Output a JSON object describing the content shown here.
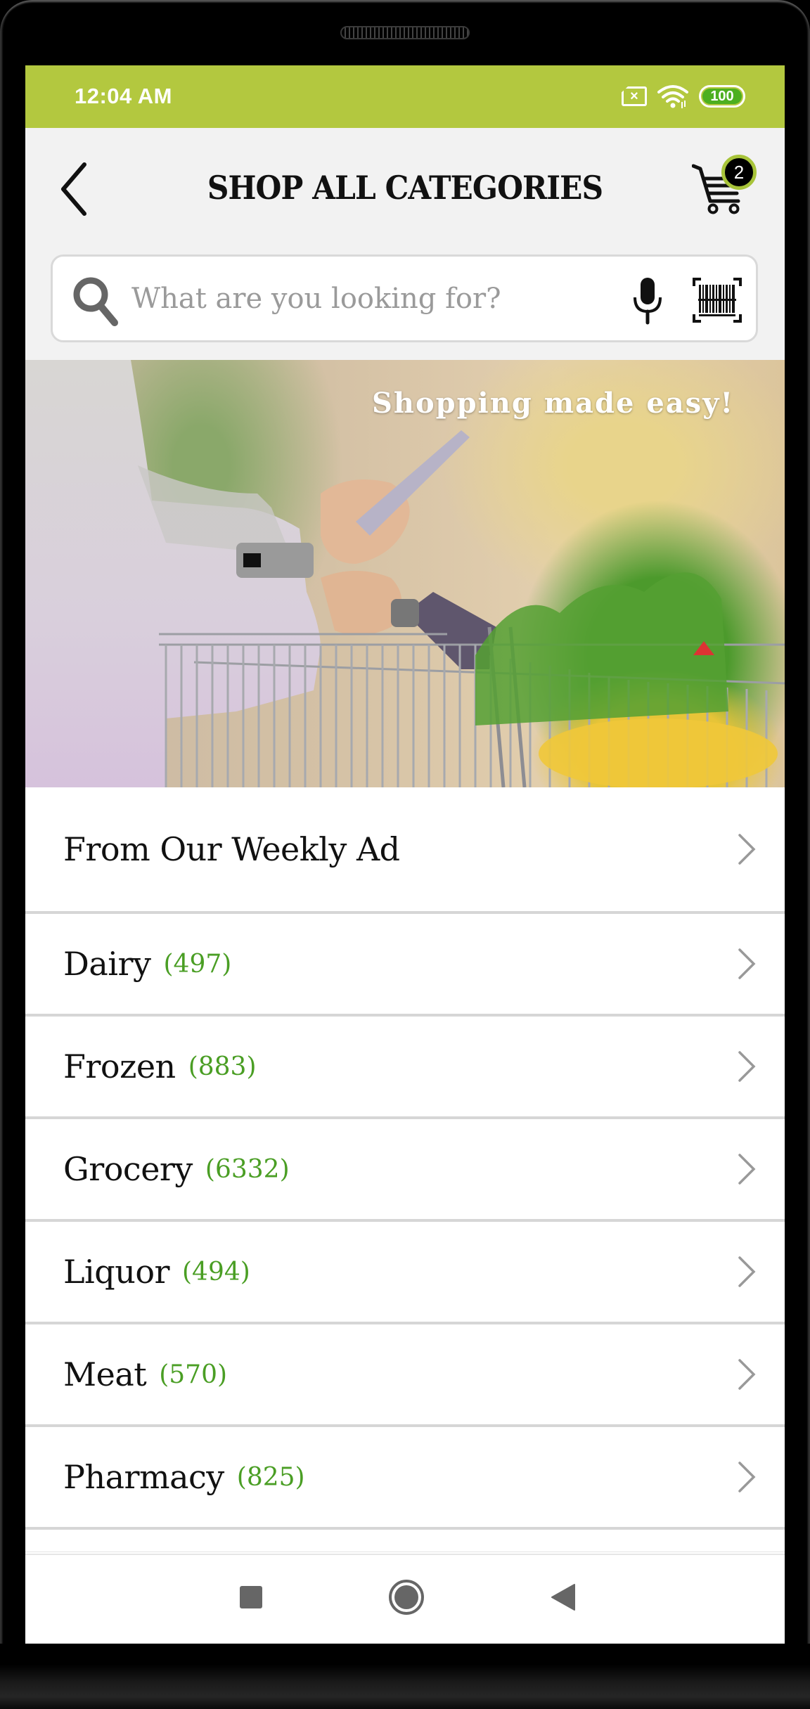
{
  "status_bar": {
    "time": "12:04 AM",
    "sim_icon": "no-sim-icon",
    "sim_glyph": "×",
    "wifi_icon": "wifi-icon",
    "battery_level": "100",
    "background_color": "#b3c83f"
  },
  "header": {
    "back_icon": "chevron-left-icon",
    "title": "SHOP ALL CATEGORIES",
    "cart_icon": "shopping-cart-icon",
    "cart_count": "2",
    "badge_ring_color": "#a8c43a"
  },
  "search": {
    "value": "",
    "placeholder": "What are you looking for?",
    "search_icon": "magnifier-icon",
    "mic_icon": "microphone-icon",
    "barcode_icon": "barcode-scan-icon"
  },
  "banner": {
    "headline": "Shopping made easy!",
    "image_description": "Shopper holding a phone while pushing a grocery cart"
  },
  "categories": [
    {
      "name": "From Our Weekly Ad",
      "count": ""
    },
    {
      "name": "Dairy",
      "count": "(497)"
    },
    {
      "name": "Frozen",
      "count": "(883)"
    },
    {
      "name": "Grocery",
      "count": "(6332)"
    },
    {
      "name": "Liquor",
      "count": "(494)"
    },
    {
      "name": "Meat",
      "count": "(570)"
    },
    {
      "name": "Pharmacy",
      "count": "(825)"
    }
  ],
  "colors": {
    "count_text": "#4a9e24",
    "chevron": "#999999"
  },
  "navbar": {
    "recent_icon": "square-recents-icon",
    "home_icon": "circle-home-icon",
    "back_icon": "triangle-back-icon"
  }
}
